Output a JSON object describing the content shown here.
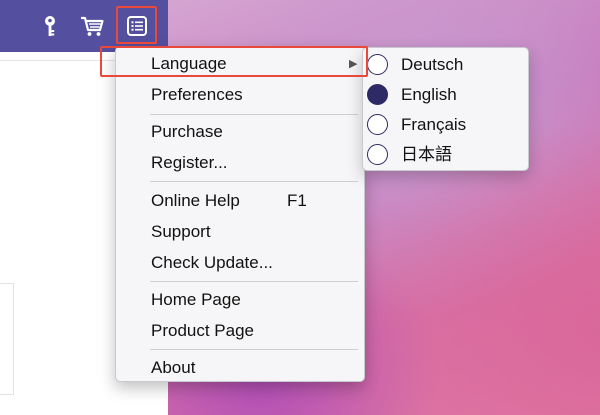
{
  "toolbar": {
    "icons": [
      "key-icon",
      "cart-icon",
      "menu-list-icon"
    ],
    "colors": {
      "titlebar": "#54509f",
      "highlight": "#e8493b",
      "radio": "#2e2a66"
    }
  },
  "menu": {
    "language": "Language",
    "preferences": "Preferences",
    "purchase": "Purchase",
    "register": "Register...",
    "online_help": "Online Help",
    "online_help_shortcut": "F1",
    "support": "Support",
    "check_update": "Check Update...",
    "home_page": "Home Page",
    "product_page": "Product Page",
    "about": "About",
    "submenu_arrow": "▶"
  },
  "language_submenu": {
    "options": [
      {
        "label": "Deutsch",
        "selected": false
      },
      {
        "label": "English",
        "selected": true
      },
      {
        "label": "Français",
        "selected": false
      },
      {
        "label": "日本語",
        "selected": false
      }
    ]
  }
}
